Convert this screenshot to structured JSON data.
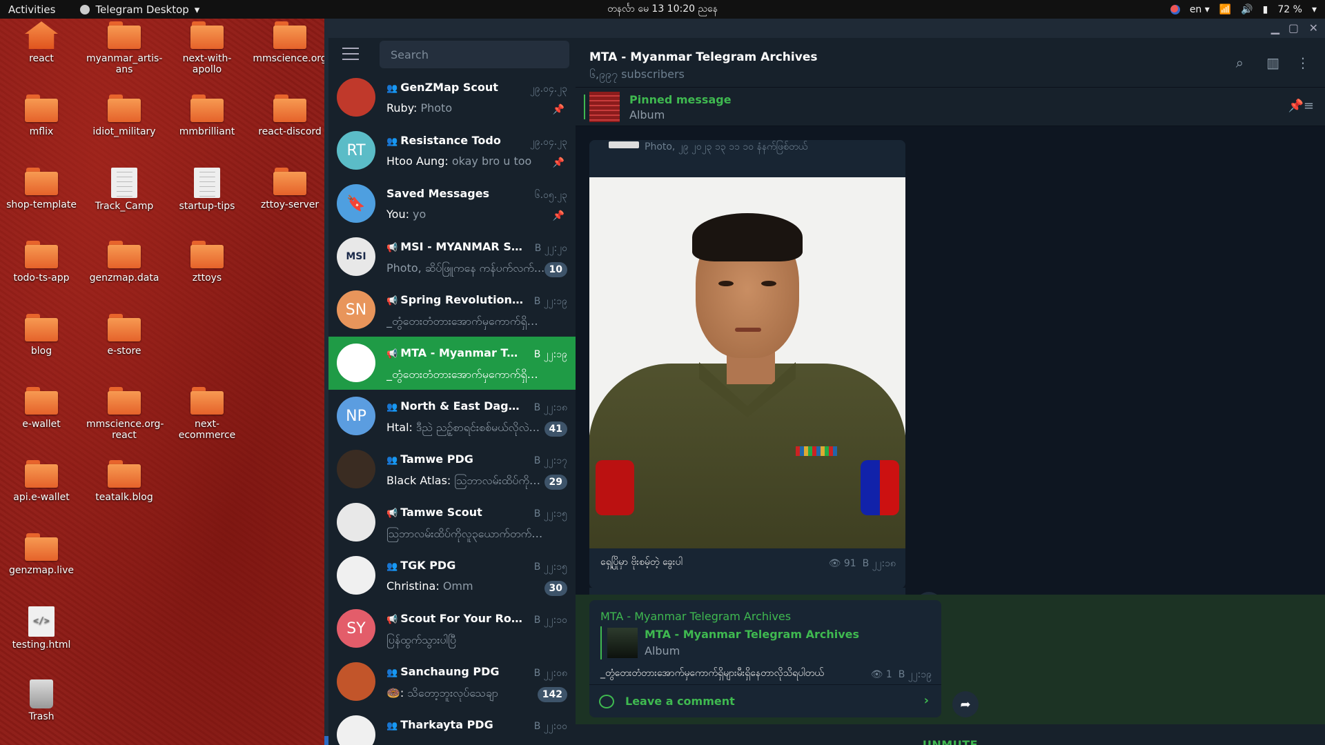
{
  "topbar": {
    "activities": "Activities",
    "app_name": "Telegram Desktop",
    "clock": "တနင်္လာ မေ 13  10:20 ညနေ",
    "lang": "en",
    "battery": "72 %"
  },
  "desktop_icons": [
    {
      "label": "react",
      "kind": "home"
    },
    {
      "label": "myanmar_artis-ans",
      "kind": "folder"
    },
    {
      "label": "next-with-apollo",
      "kind": "folder"
    },
    {
      "label": "mmscience.org",
      "kind": "folder"
    },
    {
      "label": "mflix",
      "kind": "folder"
    },
    {
      "label": "idiot_military",
      "kind": "folder"
    },
    {
      "label": "mmbrilliant",
      "kind": "folder"
    },
    {
      "label": "react-discord",
      "kind": "folder"
    },
    {
      "label": "shop-template",
      "kind": "folder"
    },
    {
      "label": "Track_Camp",
      "kind": "doc"
    },
    {
      "label": "startup-tips",
      "kind": "doc"
    },
    {
      "label": "zttoy-server",
      "kind": "folder"
    },
    {
      "label": "todo-ts-app",
      "kind": "folder"
    },
    {
      "label": "genzmap.data",
      "kind": "folder"
    },
    {
      "label": "zttoys",
      "kind": "folder"
    },
    {
      "label": "blog",
      "kind": "folder"
    },
    {
      "label": "e-store",
      "kind": "folder"
    },
    {
      "label": "e-wallet",
      "kind": "folder"
    },
    {
      "label": "mmscience.org-react",
      "kind": "folder"
    },
    {
      "label": "next-ecommerce",
      "kind": "folder"
    },
    {
      "label": "api.e-wallet",
      "kind": "folder"
    },
    {
      "label": "teatalk.blog",
      "kind": "folder"
    },
    {
      "label": "genzmap.live",
      "kind": "folder"
    },
    {
      "label": "testing.html",
      "kind": "html"
    },
    {
      "label": "Trash",
      "kind": "trash"
    }
  ],
  "search": {
    "placeholder": "Search"
  },
  "chats": [
    {
      "name": "GenZMap Scout",
      "type": "group",
      "date": "၂၉.၀၄.၂၃",
      "sender": "Ruby:",
      "preview": " Photo",
      "badge": "",
      "pinned": true,
      "avatar_text": "",
      "avatar_color": "#c0392b"
    },
    {
      "name": "Resistance Todo",
      "type": "group",
      "date": "၂၉.၀၄.၂၃",
      "sender": "Htoo Aung:",
      "preview": " okay bro u too",
      "badge": "",
      "pinned": true,
      "avatar_text": "RT",
      "avatar_color": "#5bbcc7"
    },
    {
      "name": "Saved Messages",
      "type": "",
      "date": "၆.၀၅.၂၃",
      "sender": "You:",
      "preview": " yo",
      "badge": "",
      "pinned": true,
      "avatar_text": "🔖",
      "avatar_color": "#4e9fe0"
    },
    {
      "name": "MSI - MYANMAR SEC...",
      "type": "channel",
      "date": "B ၂၂:၂၀",
      "sender": "",
      "preview": "Photo, ဆိပ်ဖြူကနေ ကန်ပက်လက်...",
      "badge": "10",
      "pinned": false,
      "avatar_text": "MSI",
      "avatar_color": "#e8e8e8"
    },
    {
      "name": "Spring Revolution Tr...",
      "type": "channel",
      "date": "B ၂၂:၁၉",
      "sender": "",
      "preview": "_တွံတေးတံတားအောက်မှကောက်ရှိများမီး...",
      "badge": "",
      "pinned": false,
      "avatar_text": "SN",
      "avatar_color": "#e8955b"
    },
    {
      "name": "MTA - Myanmar Tele...",
      "type": "channel",
      "date": "B ၂၂:၁၉",
      "sender": "",
      "preview": "_တွံတေးတံတားအောက်မှကောက်ရှိများမီး...",
      "badge": "",
      "pinned": false,
      "avatar_text": "",
      "avatar_color": "#ffffff",
      "active": true
    },
    {
      "name": "North & East Dagon ...",
      "type": "group",
      "date": "B ၂၂:၁၈",
      "sender": "Htal:",
      "preview": " ဒီညဲ ညဉ့်စာရင်းစစ်မယ်လိုလဲ...",
      "badge": "41",
      "pinned": false,
      "avatar_text": "NP",
      "avatar_color": "#5b9de0"
    },
    {
      "name": "Tamwe PDG",
      "type": "group",
      "date": "B ၂၂:၁၇",
      "sender": "Black Atlas:",
      "preview": " ဩဘာလမ်းထိပ်ကိုလူ...",
      "badge": "29",
      "pinned": false,
      "avatar_text": "",
      "avatar_color": "#3a2c22"
    },
    {
      "name": "Tamwe Scout",
      "type": "channel",
      "date": "B ၂၂:၁၅",
      "sender": "",
      "preview": "ဩဘာလမ်းထိပ်ကိုလူ၃ယောက်တက်သွားပါ...",
      "badge": "",
      "pinned": false,
      "avatar_text": "",
      "avatar_color": "#e8e8e8"
    },
    {
      "name": "TGK PDG",
      "type": "group",
      "date": "B ၂၂:၁၅",
      "sender": "Christina:",
      "preview": " Omm",
      "badge": "30",
      "pinned": false,
      "avatar_text": "",
      "avatar_color": "#f0f0f0"
    },
    {
      "name": "Scout For Your Route...",
      "type": "channel",
      "date": "B ၂၂:၁၀",
      "sender": "",
      "preview": "ပြန်ထွက်သွားပါပြီ",
      "badge": "",
      "pinned": false,
      "avatar_text": "SY",
      "avatar_color": "#e35d6a"
    },
    {
      "name": "Sanchaung PDG",
      "type": "group",
      "date": "B ၂၂:၀၈",
      "sender": "🍩:",
      "preview": " သိတော့ဘူးလုပ်သေချာ",
      "badge": "142",
      "pinned": false,
      "avatar_text": "",
      "avatar_color": "#c2552a"
    },
    {
      "name": "Tharkayta PDG",
      "type": "group",
      "date": "B ၂၂:၀၀",
      "sender": "",
      "preview": "",
      "badge": "",
      "pinned": false,
      "avatar_text": "",
      "avatar_color": "#f0f0f0"
    }
  ],
  "conversation": {
    "title": "MTA - Myanmar Telegram Archives",
    "subtitle": "၆,၉၉၇ subscribers",
    "pinned_title": "Pinned message",
    "pinned_sub": "Album",
    "cut_text": "Photo, ၂၉ ၂၀၂၃ ၁၃ ၁၁ ၁၀ နံနက်ဖြစ်တယ်",
    "msg1_caption": "ရှေ့ပြိုမှာ ဗိုးစမ့်တဲ့ ခွေးပါ",
    "msg1_views": "91",
    "msg1_time": "B ၂၂:၁၈",
    "comment_label": "Leave a comment",
    "msg2_from": "MTA - Myanmar Telegram Archives",
    "msg2_reply_name": "MTA - Myanmar Telegram Archives",
    "msg2_reply_sub": "Album",
    "msg2_text": "_တွံတေးတံတားအောက်မှကောက်ရှိများမီးရှိနေတာလိုသိရပါတယ်",
    "msg2_views": "1",
    "msg2_time": "B ၂၂:၁၉",
    "unmute": "UNMUTE"
  },
  "icons": {
    "view": "eye-icon",
    "share": "share-icon",
    "search": "search-icon",
    "sidebar": "sidebar-toggle-icon",
    "more": "more-icon"
  },
  "colors": {
    "accent_green": "#3fb950",
    "active_chat": "#1f9b46",
    "dark_bg": "#17212b",
    "chat_bg": "#0e1621"
  }
}
